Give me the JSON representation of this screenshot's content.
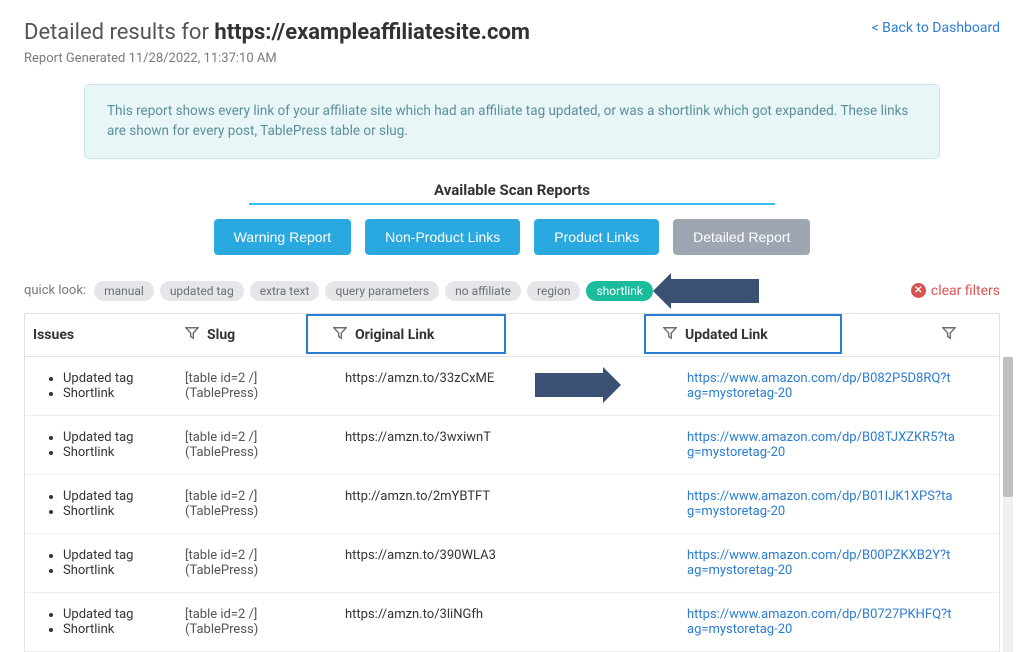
{
  "header": {
    "title_prefix": "Detailed results for ",
    "title_url": "https://exampleaffiliatesite.com",
    "subtitle": "Report Generated 11/28/2022, 11:37:10 AM",
    "back_link": "< Back to Dashboard"
  },
  "info_box": "This report shows every link of your affiliate site which had an affiliate tag updated, or was a shortlink which got expanded. These links are shown for every post, TablePress table or slug.",
  "reports": {
    "section_title": "Available Scan Reports",
    "buttons": [
      {
        "label": "Warning Report",
        "style": "blue"
      },
      {
        "label": "Non-Product Links",
        "style": "blue"
      },
      {
        "label": "Product Links",
        "style": "blue"
      },
      {
        "label": "Detailed Report",
        "style": "gray"
      }
    ]
  },
  "quicklook": {
    "label": "quick look:",
    "pills": [
      {
        "label": "manual",
        "active": false
      },
      {
        "label": "updated tag",
        "active": false
      },
      {
        "label": "extra text",
        "active": false
      },
      {
        "label": "query parameters",
        "active": false
      },
      {
        "label": "no affiliate",
        "active": false
      },
      {
        "label": "region",
        "active": false
      },
      {
        "label": "shortlink",
        "active": true
      }
    ],
    "clear": "clear filters"
  },
  "table": {
    "headers": {
      "issues": "Issues",
      "slug": "Slug",
      "original": "Original Link",
      "updated": "Updated Link"
    },
    "rows": [
      {
        "issues": [
          "Updated tag",
          "Shortlink"
        ],
        "slug": "[table id=2 /] (TablePress)",
        "original": "https://amzn.to/33zCxME",
        "updated": "https://www.amazon.com/dp/B082P5D8RQ?tag=mystoretag-20"
      },
      {
        "issues": [
          "Updated tag",
          "Shortlink"
        ],
        "slug": "[table id=2 /] (TablePress)",
        "original": "https://amzn.to/3wxiwnT",
        "updated": "https://www.amazon.com/dp/B08TJXZKR5?tag=mystoretag-20"
      },
      {
        "issues": [
          "Updated tag",
          "Shortlink"
        ],
        "slug": "[table id=2 /] (TablePress)",
        "original": "http://amzn.to/2mYBTFT",
        "updated": "https://www.amazon.com/dp/B01IJK1XPS?tag=mystoretag-20"
      },
      {
        "issues": [
          "Updated tag",
          "Shortlink"
        ],
        "slug": "[table id=2 /] (TablePress)",
        "original": "https://amzn.to/390WLA3",
        "updated": "https://www.amazon.com/dp/B00PZKXB2Y?tag=mystoretag-20"
      },
      {
        "issues": [
          "Updated tag",
          "Shortlink"
        ],
        "slug": "[table id=2 /] (TablePress)",
        "original": "https://amzn.to/3liNGfh",
        "updated": "https://www.amazon.com/dp/B0727PKHFQ?tag=mystoretag-20"
      }
    ]
  }
}
